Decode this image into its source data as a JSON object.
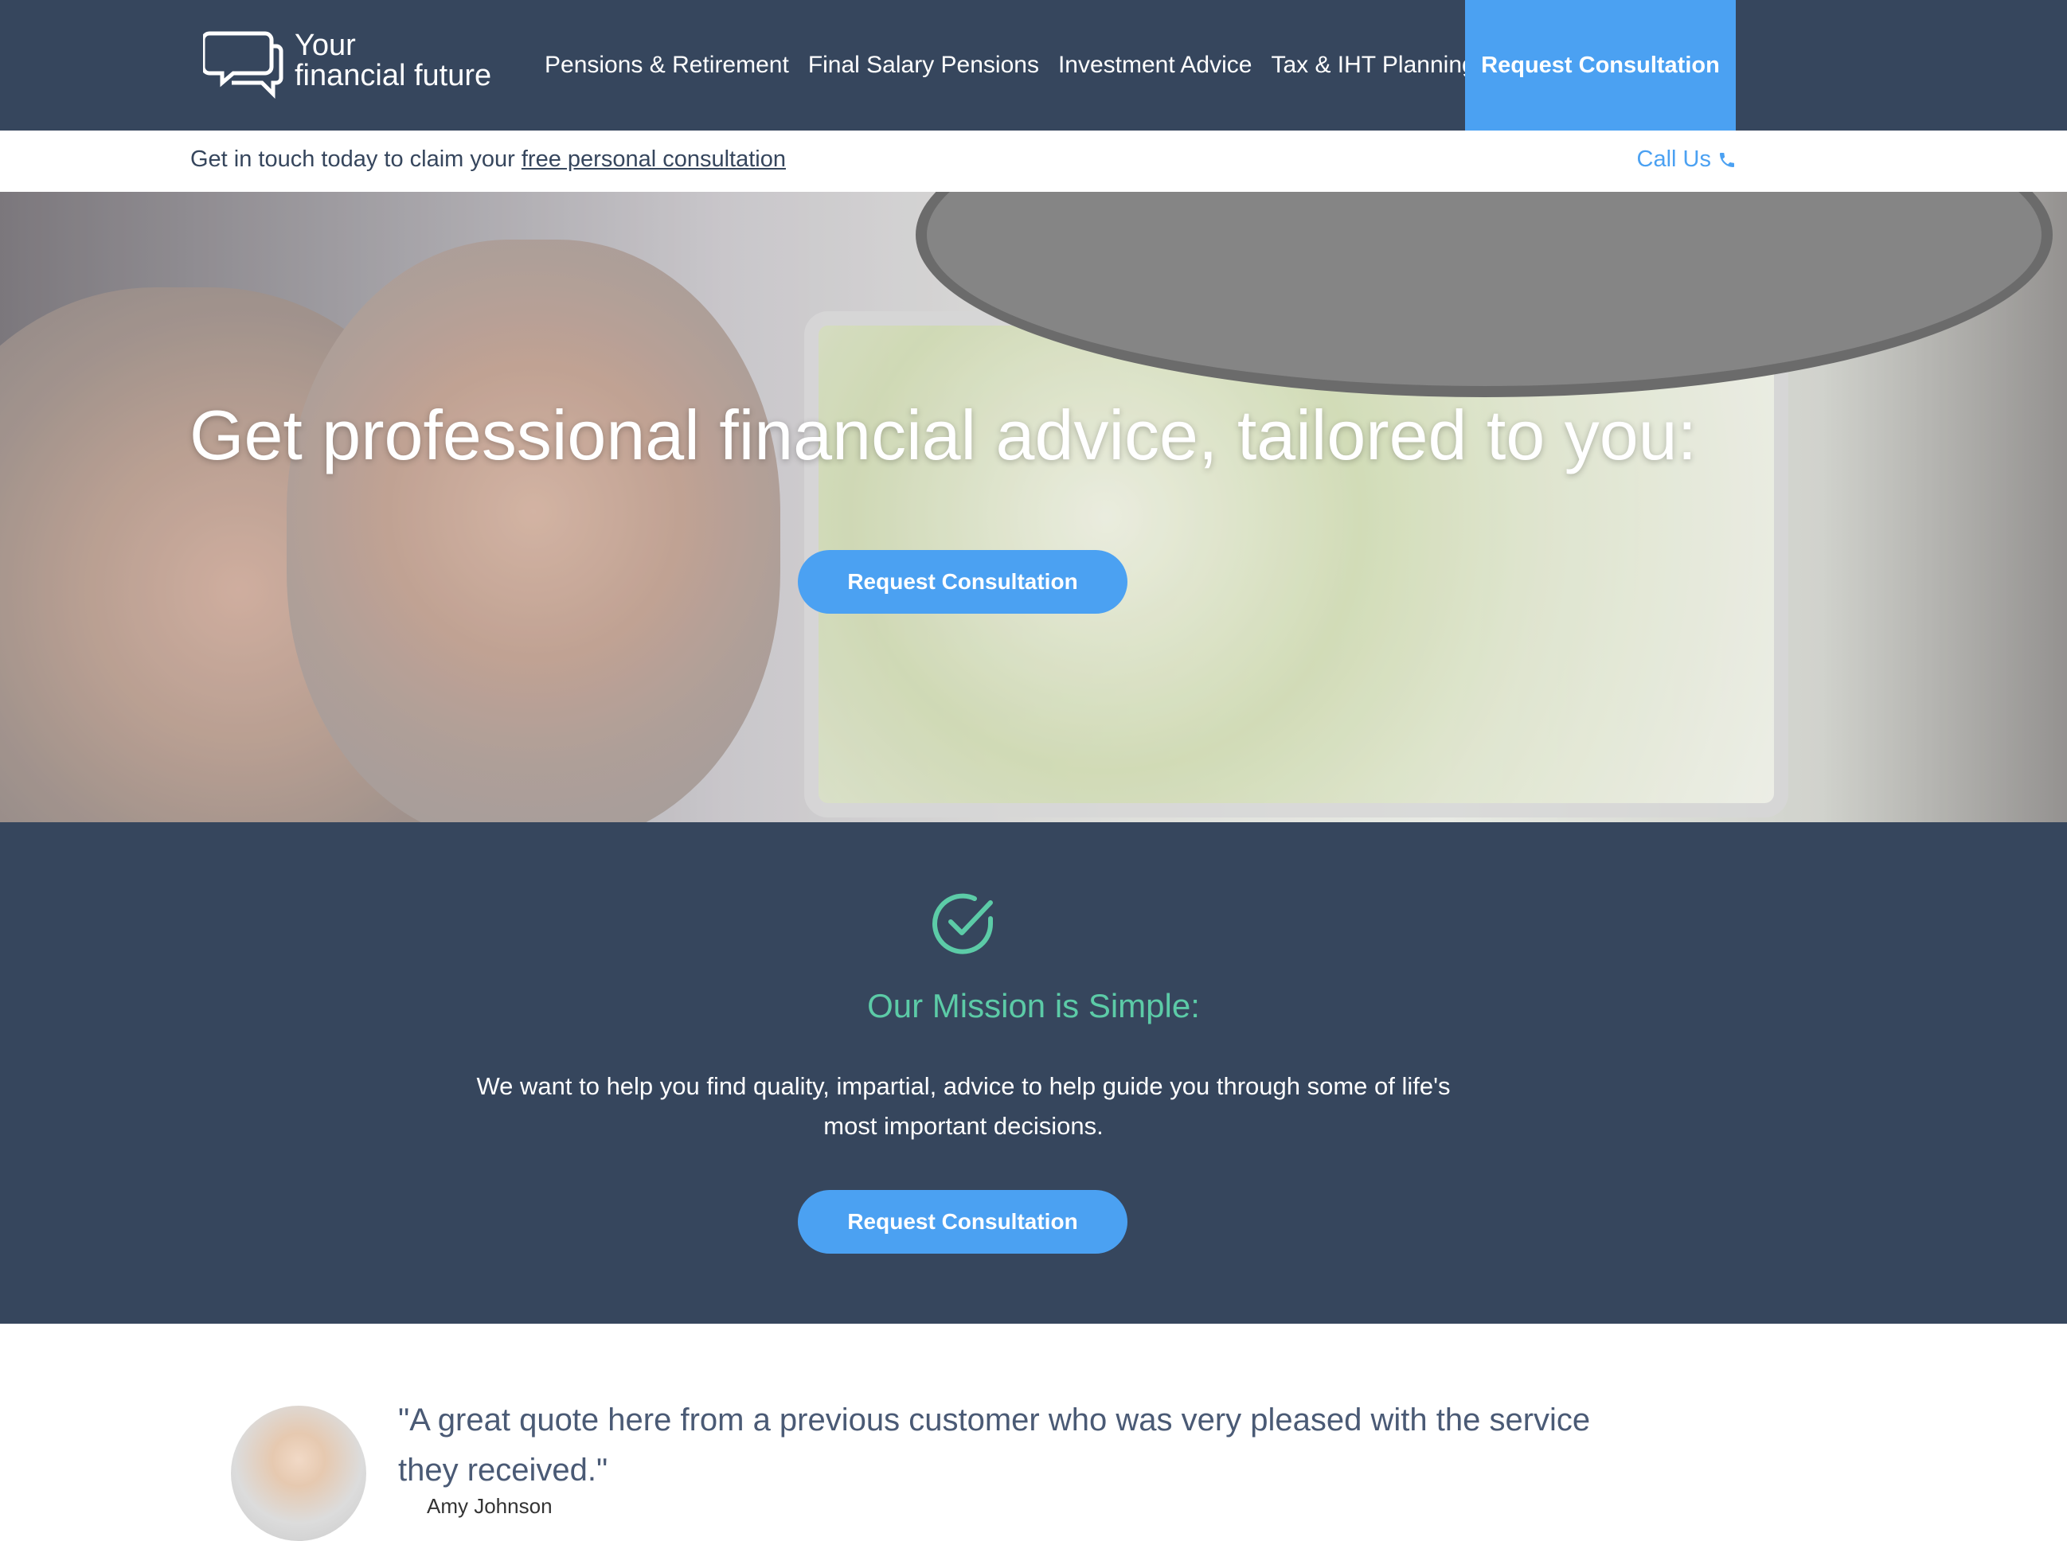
{
  "header": {
    "logo_line1": "Your",
    "logo_line2": "financial future",
    "nav": [
      "Pensions & Retirement",
      "Final Salary Pensions",
      "Investment Advice",
      "Tax & IHT Planning"
    ],
    "cta": "Request Consultation"
  },
  "subbar": {
    "text": "Get in touch today to claim your ",
    "link": "free personal consultation",
    "call": "Call Us",
    "call_icon": "phone-icon"
  },
  "hero": {
    "title": "Get professional financial advice, tailored to you:",
    "button": "Request Consultation"
  },
  "mission": {
    "icon": "check-circle-icon",
    "title": "Our Mission is Simple:",
    "text": "We want to help you find quality, impartial, advice to help guide you through some of life's most important decisions.",
    "button": "Request Consultation"
  },
  "testimonial": {
    "quote": "\"A great quote here from a previous customer who was very pleased with the service they received.\"",
    "author": "Amy Johnson"
  },
  "colors": {
    "navy": "#36465d",
    "accent_blue": "#4ba1f2",
    "mint": "#5ccba7"
  }
}
